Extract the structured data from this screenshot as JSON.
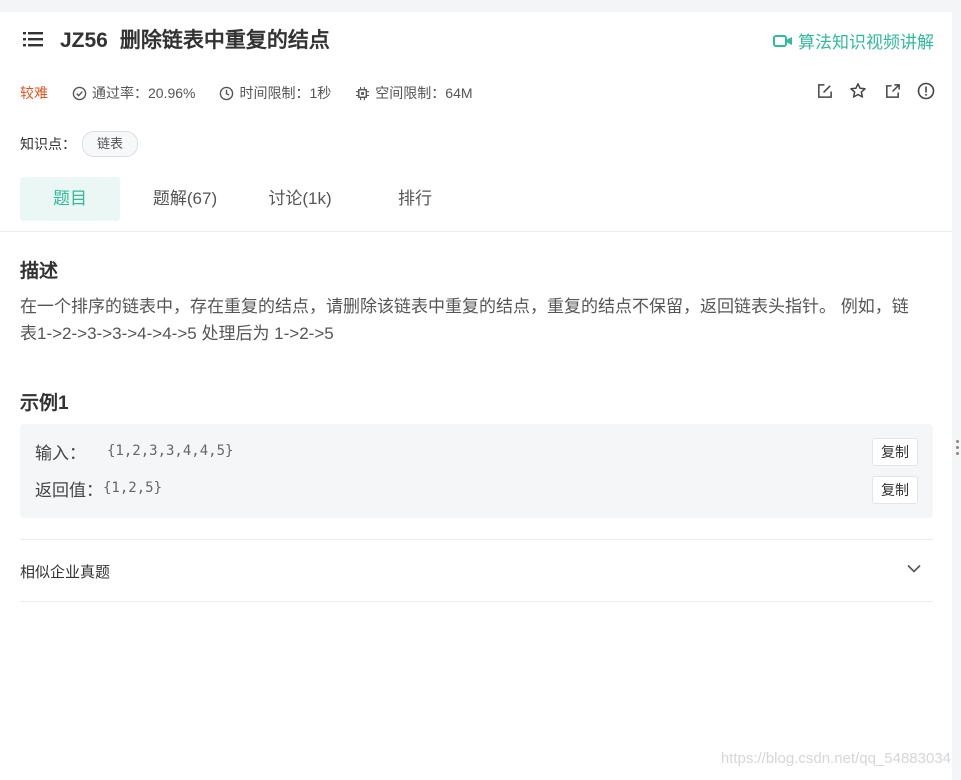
{
  "header": {
    "problem_id": "JZ56",
    "problem_title": "删除链表中重复的结点",
    "video_link": "算法知识视频讲解"
  },
  "meta": {
    "difficulty": "较难",
    "pass_rate": "通过率：20.96%",
    "time_limit": "时间限制：1秒",
    "space_limit": "空间限制：64M"
  },
  "knowledge": {
    "label": "知识点：",
    "tags": [
      "链表"
    ]
  },
  "tabs": [
    {
      "label": "题目"
    },
    {
      "label": "题解(67)"
    },
    {
      "label": "讨论(1k)"
    },
    {
      "label": "排行"
    }
  ],
  "description": {
    "heading": "描述",
    "text": "在一个排序的链表中，存在重复的结点，请删除该链表中重复的结点，重复的结点不保留，返回链表头指针。 例如，链表1->2->3->3->4->4->5 处理后为 1->2->5"
  },
  "example": {
    "heading": "示例1",
    "input_label": "输入：",
    "input_value": "{1,2,3,3,4,4,5}",
    "output_label": "返回值：",
    "output_value": "{1,2,5}",
    "copy_label": "复制"
  },
  "similar": {
    "label": "相似企业真题"
  },
  "watermark": "https://blog.csdn.net/qq_54883034",
  "colors": {
    "accent": "#32ba9c",
    "difficulty": "#e1541f"
  },
  "icons": [
    "list-icon",
    "video-icon",
    "check-circle-icon",
    "clock-icon",
    "chip-icon",
    "edit-icon",
    "star-icon",
    "share-icon",
    "alert-icon",
    "chevron-down-icon"
  ]
}
